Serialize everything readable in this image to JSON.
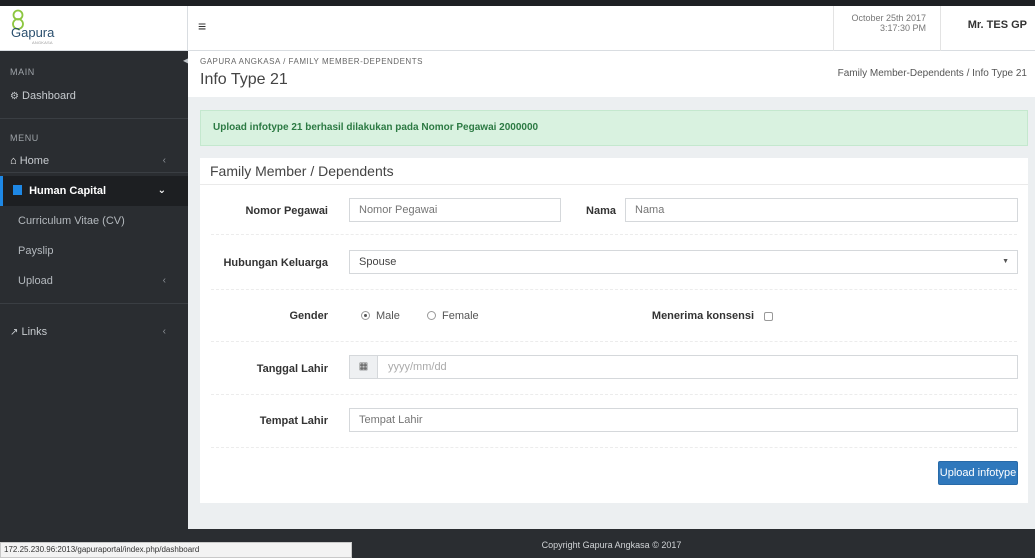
{
  "header": {
    "logo_text": "Gapura",
    "logo_sub": "ANGKASA",
    "date": "October 25th 2017",
    "time": "3:17:30 PM",
    "user": "Mr. TES GP",
    "menu_icon": "hamburger-icon"
  },
  "sidebar": {
    "main_section": "MAIN",
    "dashboard": "Dashboard",
    "menu_section": "MENU",
    "home": "Home",
    "human_capital": "Human Capital",
    "cv": "Curriculum Vitae (CV)",
    "payslip": "Payslip",
    "upload": "Upload",
    "links": "Links",
    "accent_color": "#1e88e5"
  },
  "page": {
    "breadcrumb_top": "GAPURA ANGKASA / FAMILY MEMBER-DEPENDENTS",
    "title": "Info Type 21",
    "breadcrumb_right": "Family Member-Dependents / Info Type 21"
  },
  "alert": {
    "message": "Upload infotype 21 berhasil dilakukan pada Nomor Pegawai 2000000",
    "color": "#d9f2e0"
  },
  "form": {
    "panel_title": "Family Member / Dependents",
    "nomor_pegawai_label": "Nomor Pegawai",
    "nomor_pegawai_placeholder": "Nomor Pegawai",
    "nama_label": "Nama",
    "nama_placeholder": "Nama",
    "hubungan_label": "Hubungan Keluarga",
    "hubungan_value": "Spouse",
    "gender_label": "Gender",
    "gender_male": "Male",
    "gender_female": "Female",
    "gender_selected": "Male",
    "konsensi_label": "Menerima konsensi",
    "tanggal_label": "Tanggal Lahir",
    "tanggal_placeholder": "yyyy/mm/dd",
    "tempat_label": "Tempat Lahir",
    "tempat_placeholder": "Tempat Lahir",
    "submit_label": "Upload infotype",
    "button_color": "#2f78bc"
  },
  "footer": {
    "copyright": "Copyright Gapura Angkasa © 2017"
  },
  "statusbar": {
    "url": "172.25.230.96:2013/gapuraportal/index.php/dashboard"
  }
}
